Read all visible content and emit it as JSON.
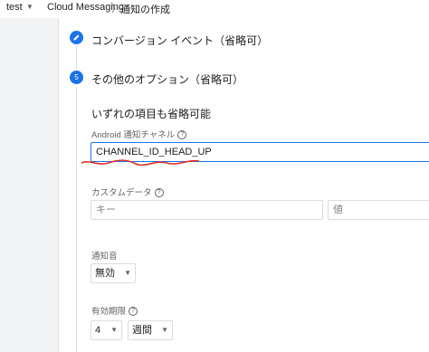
{
  "breadcrumb": {
    "project": "test",
    "section": "Cloud Messaging",
    "separator": "〉",
    "page": "通知の作成"
  },
  "steps": [
    {
      "icon": "pencil-icon",
      "title": "コンバージョン イベント（省略可）"
    },
    {
      "number": "5",
      "title": "その他のオプション（省略可）"
    }
  ],
  "options": {
    "heading": "いずれの項目も省略可能",
    "channel": {
      "label": "Android 通知チャネル",
      "value": "CHANNEL_ID_HEAD_UP"
    },
    "custom_data": {
      "label": "カスタムデータ",
      "key_placeholder": "キー",
      "value_placeholder": "値"
    },
    "sound": {
      "label": "通知音",
      "selected": "無効"
    },
    "expiry": {
      "label": "有効期限",
      "number": "4",
      "unit": "週間"
    }
  },
  "colors": {
    "accent": "#1a73e8",
    "annotation": "#d93025"
  }
}
